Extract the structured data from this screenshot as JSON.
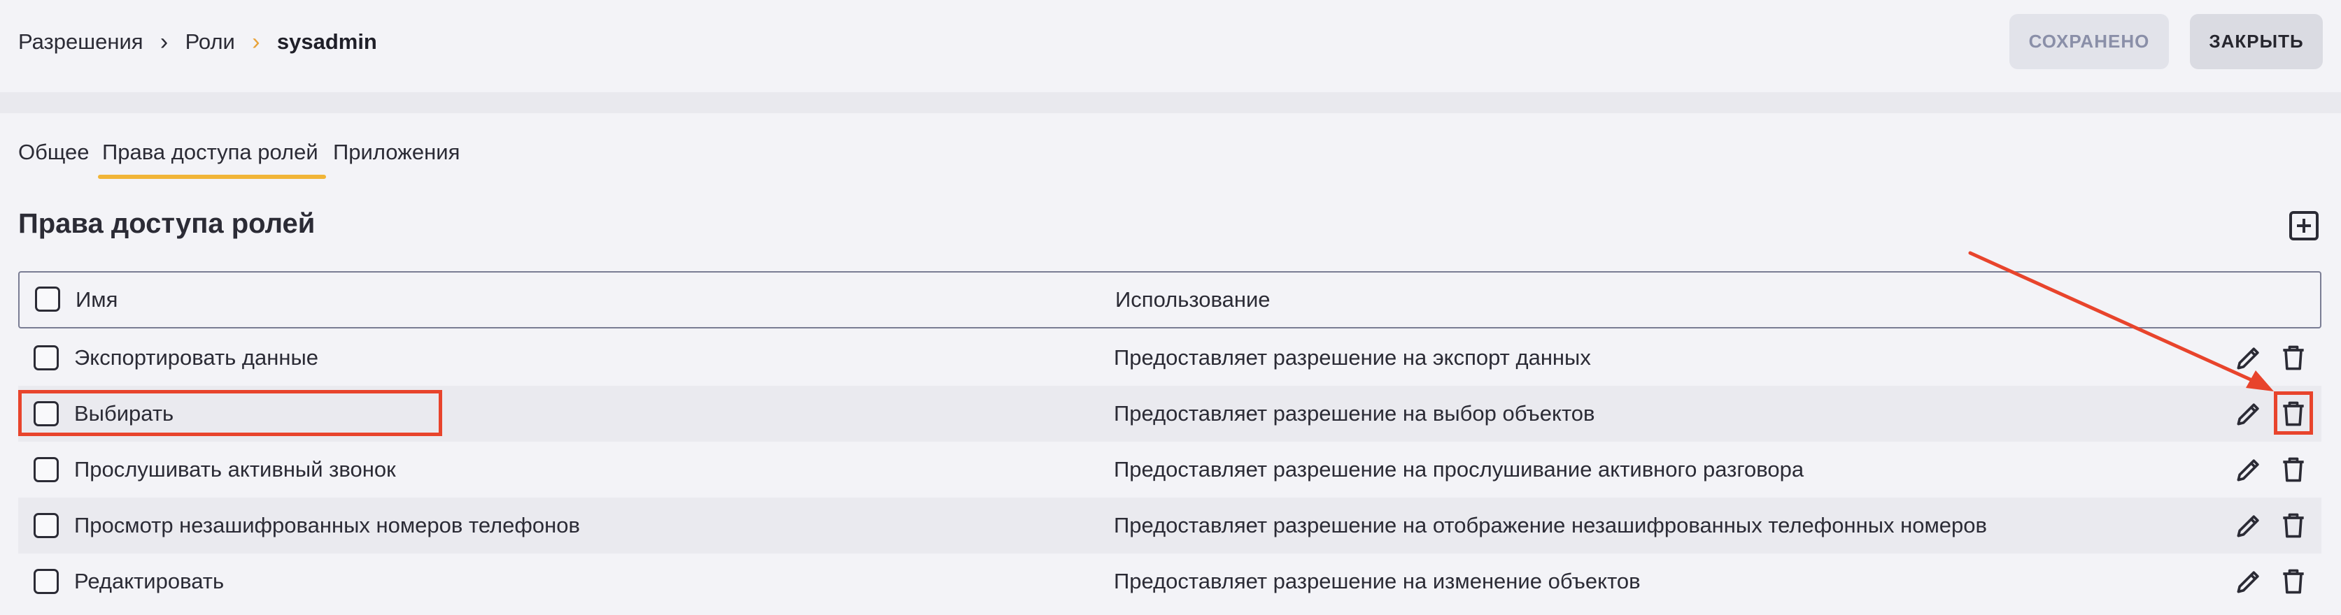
{
  "breadcrumb": {
    "items": [
      "Разрешения",
      "Роли",
      "sysadmin"
    ]
  },
  "buttons": {
    "saved": "СОХРАНЕНО",
    "close": "ЗАКРЫТЬ"
  },
  "tabs": [
    "Общее",
    "Права доступа ролей",
    "Приложения"
  ],
  "active_tab": "Права доступа ролей",
  "section": {
    "title": "Права доступа ролей",
    "add_icon": "plus-square-icon"
  },
  "table": {
    "columns": [
      "Имя",
      "Использование"
    ],
    "rows": [
      {
        "name": "Экспортировать данные",
        "usage": "Предоставляет разрешение на экспорт данных"
      },
      {
        "name": "Выбирать",
        "usage": "Предоставляет разрешение на выбор объектов"
      },
      {
        "name": "Прослушивать активный звонок",
        "usage": "Предоставляет разрешение на прослушивание активного разговора"
      },
      {
        "name": "Просмотр незашифрованных номеров телефонов",
        "usage": "Предоставляет разрешение на отображение незашифрованных телефонных номеров"
      },
      {
        "name": "Редактировать",
        "usage": "Предоставляет разрешение на изменение объектов"
      }
    ],
    "row_action_icons": [
      "pencil-icon",
      "trash-icon"
    ]
  },
  "colors": {
    "accent_underline": "#f1b537",
    "annotation": "#e8442c",
    "background": "#f3f3f7",
    "alt_row": "#eaeaef"
  }
}
